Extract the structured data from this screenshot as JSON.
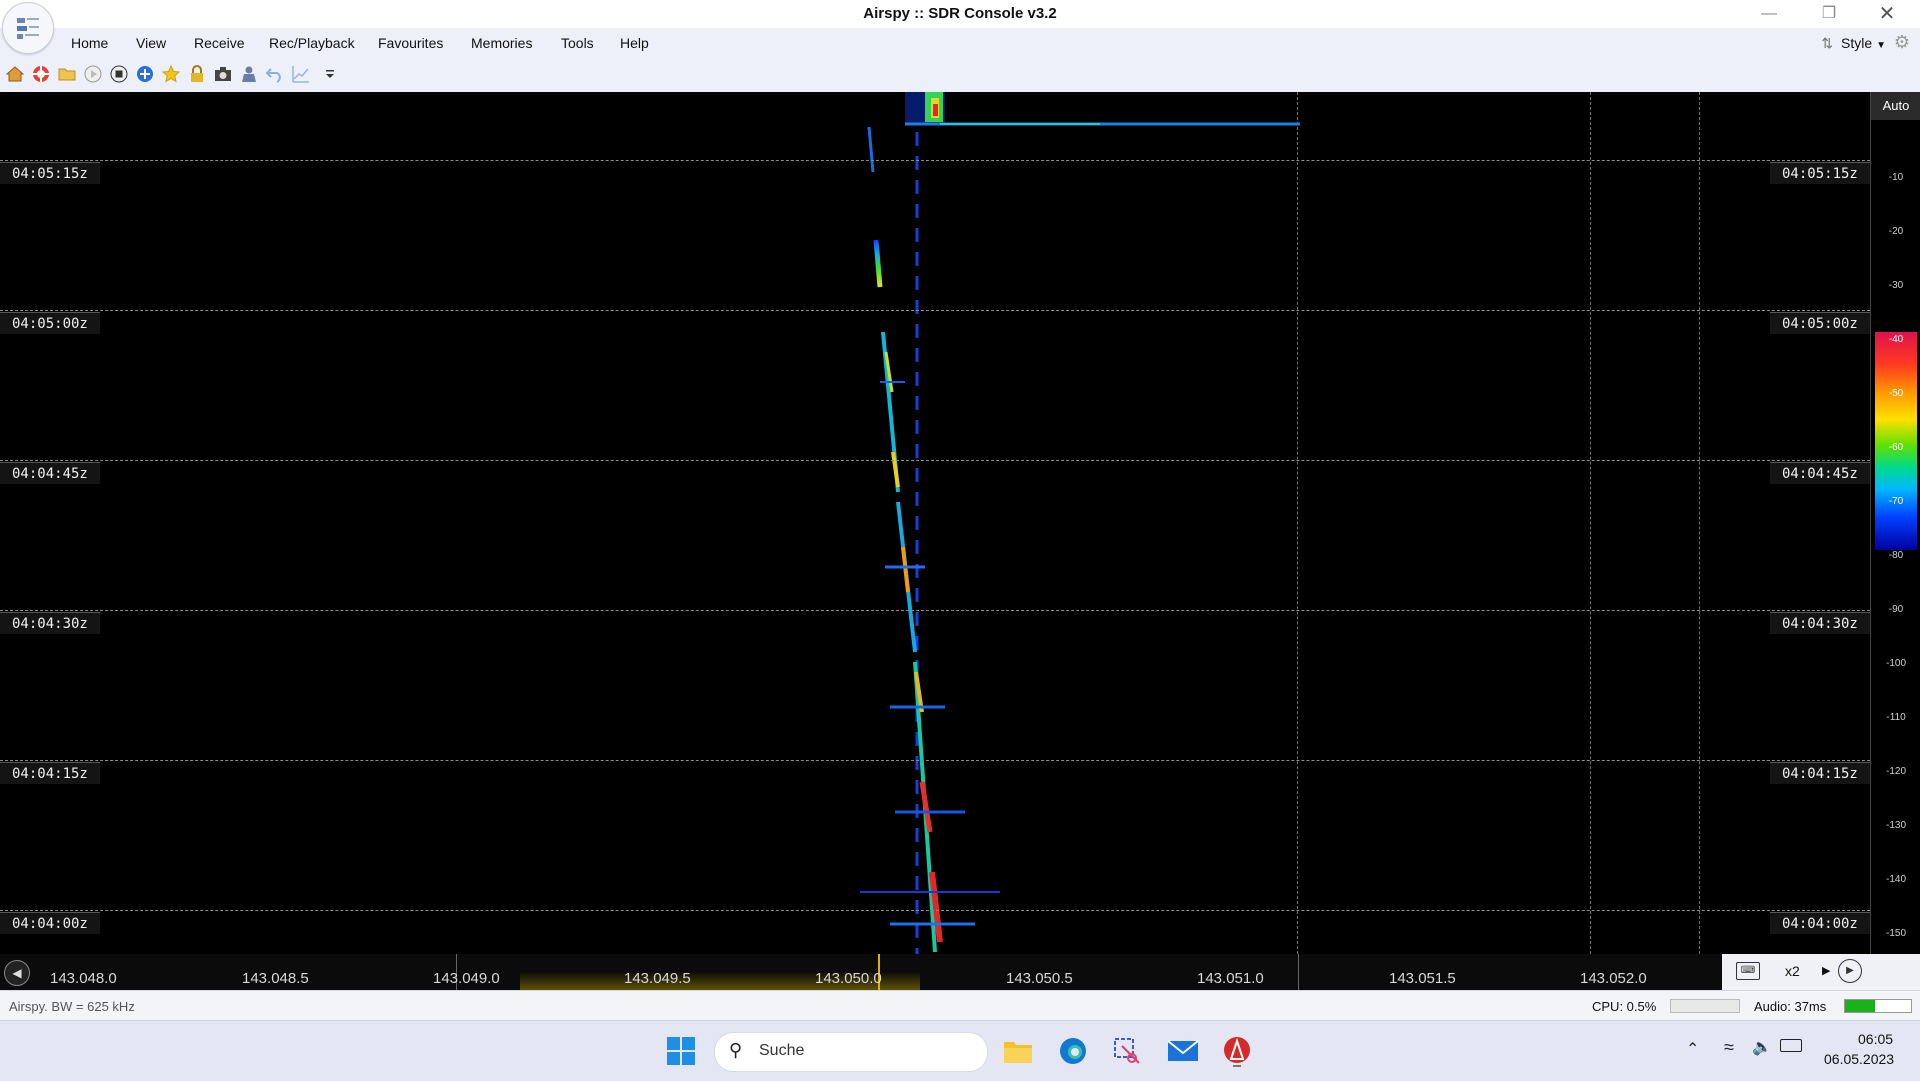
{
  "window": {
    "title": "Airspy :: SDR Console v3.2"
  },
  "menu": [
    "Home",
    "View",
    "Receive",
    "Rec/Playback",
    "Favourites",
    "Memories",
    "Tools",
    "Help"
  ],
  "style_menu": {
    "label": "Style"
  },
  "toolbar": {
    "icons": [
      "home-icon",
      "lifebuoy-icon",
      "folder-icon",
      "play-icon",
      "stop-icon",
      "add-icon",
      "favourite-star-icon",
      "lock-icon",
      "camera-icon",
      "user-icon",
      "undo-icon",
      "chart-icon",
      "dropdown-arrow-icon"
    ]
  },
  "waterfall": {
    "time_labels": [
      "04:05:15z",
      "04:05:00z",
      "04:04:45z",
      "04:04:30z",
      "04:04:15z",
      "04:04:00z"
    ],
    "colors": {
      "background": "#000000"
    }
  },
  "scale": {
    "auto_label": "Auto",
    "ticks": [
      "-10",
      "-20",
      "-30",
      "-40",
      "-50",
      "-60",
      "-70",
      "-80",
      "-90",
      "-100",
      "-110",
      "-120",
      "-130",
      "-140",
      "-150"
    ]
  },
  "frequency_bar": {
    "labels": [
      "143.048.0",
      "143.048.5",
      "143.049.0",
      "143.049.5",
      "143.050.0",
      "143.050.5",
      "143.051.0",
      "143.051.5",
      "143.052.0"
    ],
    "zoom_label": "x2"
  },
  "status": {
    "device": "Airspy. BW = 625 kHz",
    "cpu": "CPU: 0.5%",
    "audio": "Audio: 37ms"
  },
  "taskbar": {
    "search_placeholder": "Suche",
    "apps": [
      "windows-start-icon",
      "file-explorer-icon",
      "edge-browser-icon",
      "snipping-tool-icon",
      "mail-icon",
      "sdr-console-icon"
    ],
    "time": "06:05",
    "date": "06.05.2023"
  }
}
